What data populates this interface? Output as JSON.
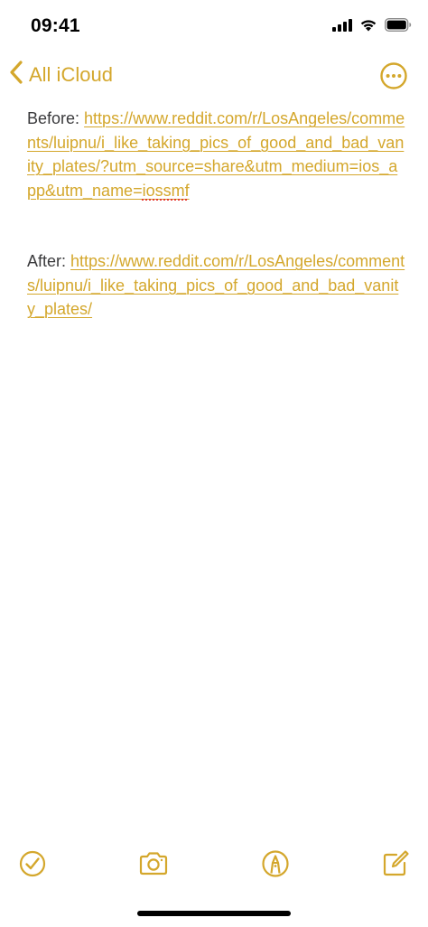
{
  "status_bar": {
    "time": "09:41",
    "icons": [
      "cellular-signal-icon",
      "wifi-icon",
      "battery-icon"
    ]
  },
  "nav": {
    "back_label": "All iCloud",
    "back_icon": "chevron-left-icon",
    "more_icon": "ellipsis-circle-icon"
  },
  "note": {
    "before": {
      "prefix": "Before: ",
      "url_main": "https://www.reddit.com/r/LosAngeles/comments/luipnu/i_like_taking_pics_of_good_and_bad_vanity_plates/?utm_source=share&utm_medium=ios_app&utm_name=",
      "url_misspelled": "iossmf"
    },
    "after": {
      "prefix": "After: ",
      "url": "https://www.reddit.com/r/LosAngeles/comments/luipnu/i_like_taking_pics_of_good_and_bad_vanity_plates/"
    }
  },
  "toolbar": {
    "items": [
      "checklist-icon",
      "camera-icon",
      "markup-pen-icon",
      "compose-icon"
    ]
  },
  "colors": {
    "accent": "#d4a72c",
    "text": "#3a3a3c",
    "spellcheck": "#e53935",
    "background": "#ffffff"
  }
}
